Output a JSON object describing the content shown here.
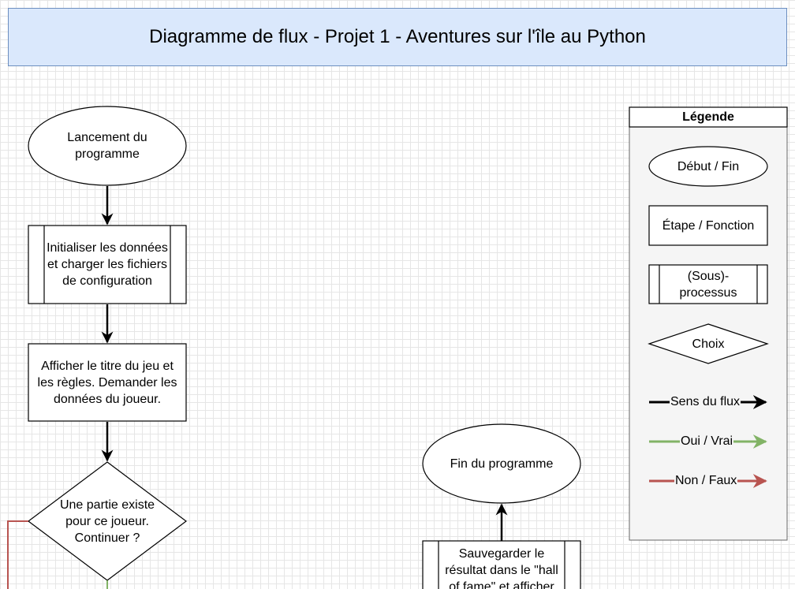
{
  "title": "Diagramme de flux - Projet 1 - Aventures sur l'île au Python",
  "nodes": {
    "start": "Lancement du programme",
    "init": "Initialiser les données et charger les fichiers de configuration",
    "show_title": "Afficher le titre du jeu et les règles. Demander les données du joueur.",
    "decision_existing": "Une partie existe pour ce joueur. Continuer ?",
    "end": "Fin du programme",
    "save": "Sauvegarder le résultat dans le \"hall of fame\" et afficher"
  },
  "legend": {
    "title": "Légende",
    "start_end": "Début / Fin",
    "step": "Étape / Fonction",
    "subprocess": "(Sous)-processus",
    "choice": "Choix",
    "flow": "Sens du flux",
    "yes": "Oui / Vrai",
    "no": "Non / Faux"
  },
  "colors": {
    "title_fill": "#dae8fc",
    "title_stroke": "#6c8ebf",
    "legend_fill": "#f5f5f5",
    "flow": "#000000",
    "yes": "#82b366",
    "no": "#b85450"
  }
}
